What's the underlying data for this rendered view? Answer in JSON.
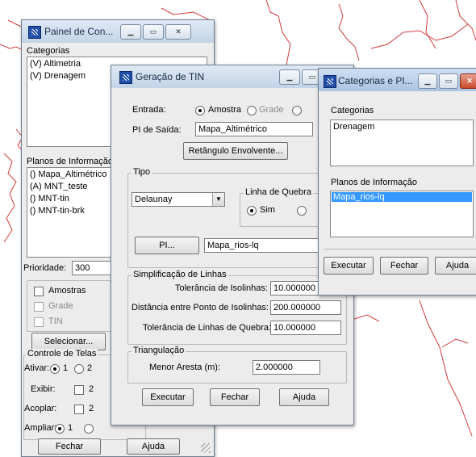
{
  "painel": {
    "title": "Painel de Con...",
    "categorias_label": "Categorias",
    "categorias": [
      "(V) Altimetria",
      "(V) Drenagem"
    ],
    "planos_label": "Planos de Informação",
    "planos": [
      "() Mapa_Altimétrico",
      "(A) MNT_teste",
      "() MNT-tin",
      "() MNT-tin-brk"
    ],
    "prioridade_label": "Prioridade:",
    "prioridade_value": "300",
    "amostras_label": "Amostras",
    "grade_label": "Grade",
    "tin_label": "TIN",
    "selecionar_label": "Selecionar...",
    "controle_label": "Controle de Telas",
    "ativar_label": "Ativar:",
    "ativar_1": "1",
    "ativar_2": "2",
    "exibir_label": "Exibir:",
    "exibir_2": "2",
    "acoplar_label": "Acoplar:",
    "acoplar_2": "2",
    "ampliar_label": "Ampliar:",
    "ampliar_1": "1",
    "fechar_label": "Fechar",
    "ajuda_label": "Ajuda"
  },
  "tin": {
    "title": "Geração de TIN",
    "entrada_label": "Entrada:",
    "entrada_options": [
      "Amostra",
      "Grade"
    ],
    "pi_saida_label": "PI de Saída:",
    "pi_saida_value": "Mapa_Altimétrico",
    "retangulo_label": "Retângulo Envolvente...",
    "tipo_label": "Tipo",
    "tipo_value": "Delaunay",
    "linha_quebra_label": "Linha de Quebra",
    "sim_label": "Sim",
    "pi_button_label": "PI...",
    "pi_value": "Mapa_rios-lq",
    "simplificacao_label": "Simplificação de Linhas",
    "tol_isolinhas_label": "Tolerância de Isolinhas:",
    "tol_isolinhas_value": "10.000000",
    "dist_label": "Distância entre Ponto de Isolinhas:",
    "dist_value": "200.000000",
    "tol_quebra_label": "Tolerância de Linhas de Quebra:",
    "tol_quebra_value": "10.000000",
    "triangulacao_label": "Triangulação",
    "menor_aresta_label": "Menor Aresta (m):",
    "menor_aresta_value": "2.000000",
    "executar_label": "Executar",
    "fechar_label": "Fechar",
    "ajuda_label": "Ajuda"
  },
  "catpi": {
    "title": "Categorias e PI...",
    "categorias_label": "Categorias",
    "categorias": [
      "Drenagem"
    ],
    "planos_label": "Planos de Informação",
    "planos": [
      "Mapa_rios-lq"
    ],
    "executar_label": "Executar",
    "fechar_label": "Fechar",
    "ajuda_label": "Ajuda"
  }
}
